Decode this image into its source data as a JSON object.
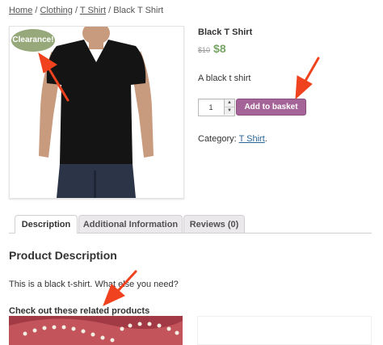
{
  "breadcrumb": {
    "home": "Home",
    "sep1": "/",
    "clothing": "Clothing",
    "sep2": "/",
    "tshirt": "T Shirt",
    "sep3": "/",
    "current": "Black T Shirt"
  },
  "badge": {
    "label": "Clearance!"
  },
  "product": {
    "title": "Black T Shirt",
    "old_price": "$10",
    "price": "$8",
    "short_description": "A black t shirt",
    "quantity": "1",
    "add_button_label": "Add to basket",
    "category_label": "Category:",
    "category_link": "T Shirt",
    "category_suffix": "."
  },
  "tabs": [
    {
      "label": "Description"
    },
    {
      "label": "Additional Information"
    },
    {
      "label": "Reviews (0)"
    }
  ],
  "description": {
    "heading": "Product Description",
    "text": "This is a black t-shirt. What else you need?"
  },
  "related": {
    "heading": "Check out these related products"
  },
  "colors": {
    "accent_button": "#a46497",
    "sale_badge": "#97a97b",
    "price": "#77a464",
    "arrow": "#f0421e"
  }
}
